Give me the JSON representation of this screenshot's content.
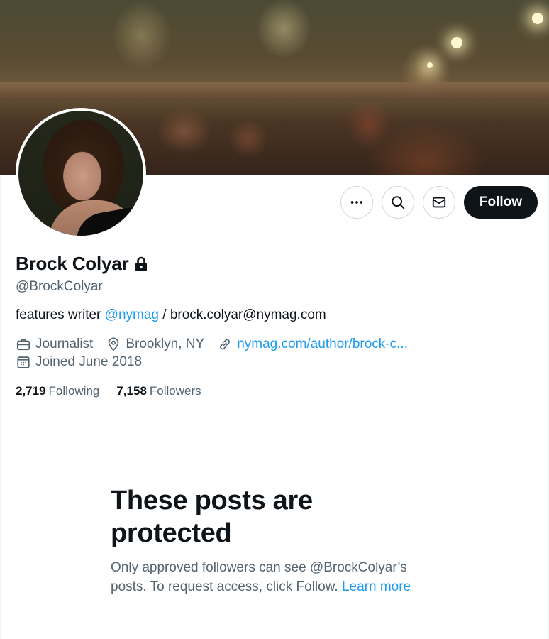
{
  "profile": {
    "display_name": "Brock Colyar",
    "handle": "@BrockColyar",
    "bio_prefix": "features writer ",
    "bio_mention": "@nymag",
    "bio_suffix": " / brock.colyar@nymag.com",
    "profession": "Journalist",
    "location": "Brooklyn, NY",
    "website": "nymag.com/author/brock-c...",
    "joined": "Joined June 2018",
    "following_count": "2,719",
    "following_label": "Following",
    "followers_count": "7,158",
    "followers_label": "Followers"
  },
  "actions": {
    "follow_label": "Follow"
  },
  "protected": {
    "title_line1": "These posts are",
    "title_line2": "protected",
    "message": "Only approved followers can see @BrockColyar’s posts. To request access, click Follow. ",
    "learn_more": "Learn more"
  },
  "icons": {
    "more": "more-icon",
    "search": "search-icon",
    "message": "mail-icon",
    "lock": "lock-icon",
    "briefcase": "briefcase-icon",
    "location": "location-pin-icon",
    "link": "link-icon",
    "calendar": "calendar-icon"
  },
  "colors": {
    "accent": "#1d9bf0",
    "text": "#0f1419",
    "secondary": "#536471",
    "follow_button": "#0f1419"
  }
}
